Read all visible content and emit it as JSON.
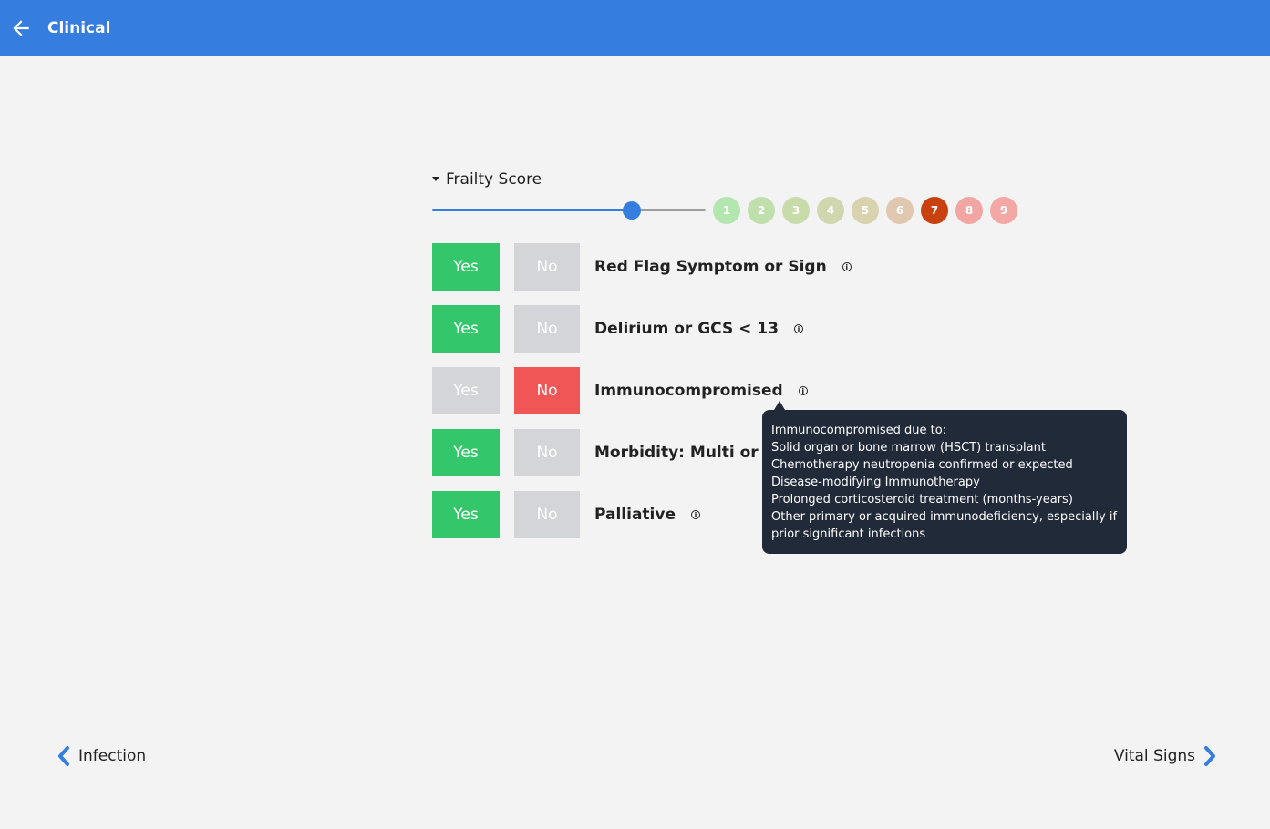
{
  "header": {
    "title": "Clinical",
    "back_icon": "arrow-left-icon"
  },
  "frailty": {
    "title": "Frailty Score",
    "slider_value_fraction": 0.73,
    "selected_score": "7",
    "scores": [
      {
        "label": "1",
        "color": "#b4e6b0"
      },
      {
        "label": "2",
        "color": "#bfe0ad"
      },
      {
        "label": "3",
        "color": "#c8dcab"
      },
      {
        "label": "4",
        "color": "#d0d6ad"
      },
      {
        "label": "5",
        "color": "#d9d2ae"
      },
      {
        "label": "6",
        "color": "#e0c8b0"
      },
      {
        "label": "7",
        "color": "#c8410e"
      },
      {
        "label": "8",
        "color": "#f2a6a3"
      },
      {
        "label": "9",
        "color": "#f3a8a6"
      }
    ]
  },
  "questions": [
    {
      "label": "Red Flag Symptom or Sign",
      "yes": "Yes",
      "no": "No",
      "answer": "yes"
    },
    {
      "label": "Delirium or GCS < 13",
      "yes": "Yes",
      "no": "No",
      "answer": "yes"
    },
    {
      "label": "Immunocompromised",
      "yes": "Yes",
      "no": "No",
      "answer": "no"
    },
    {
      "label": "Morbidity: Multi or Ad",
      "yes": "Yes",
      "no": "No",
      "answer": "yes"
    },
    {
      "label": "Palliative",
      "yes": "Yes",
      "no": "No",
      "answer": "yes"
    }
  ],
  "tooltip": {
    "lines": [
      "Immunocompromised due to:",
      "Solid organ or bone marrow (HSCT) transplant",
      "Chemotherapy neutropenia confirmed or expected",
      "Disease-modifying Immunotherapy",
      "Prolonged corticosteroid treatment (months-years)",
      "Other primary or acquired immunodeficiency, especially if prior significant infections"
    ]
  },
  "nav": {
    "prev": "Infection",
    "next": "Vital Signs"
  },
  "colors": {
    "primary": "#367de0",
    "yes_active": "#33c66b",
    "no_active": "#f05656",
    "inactive": "#d3d5d9"
  }
}
